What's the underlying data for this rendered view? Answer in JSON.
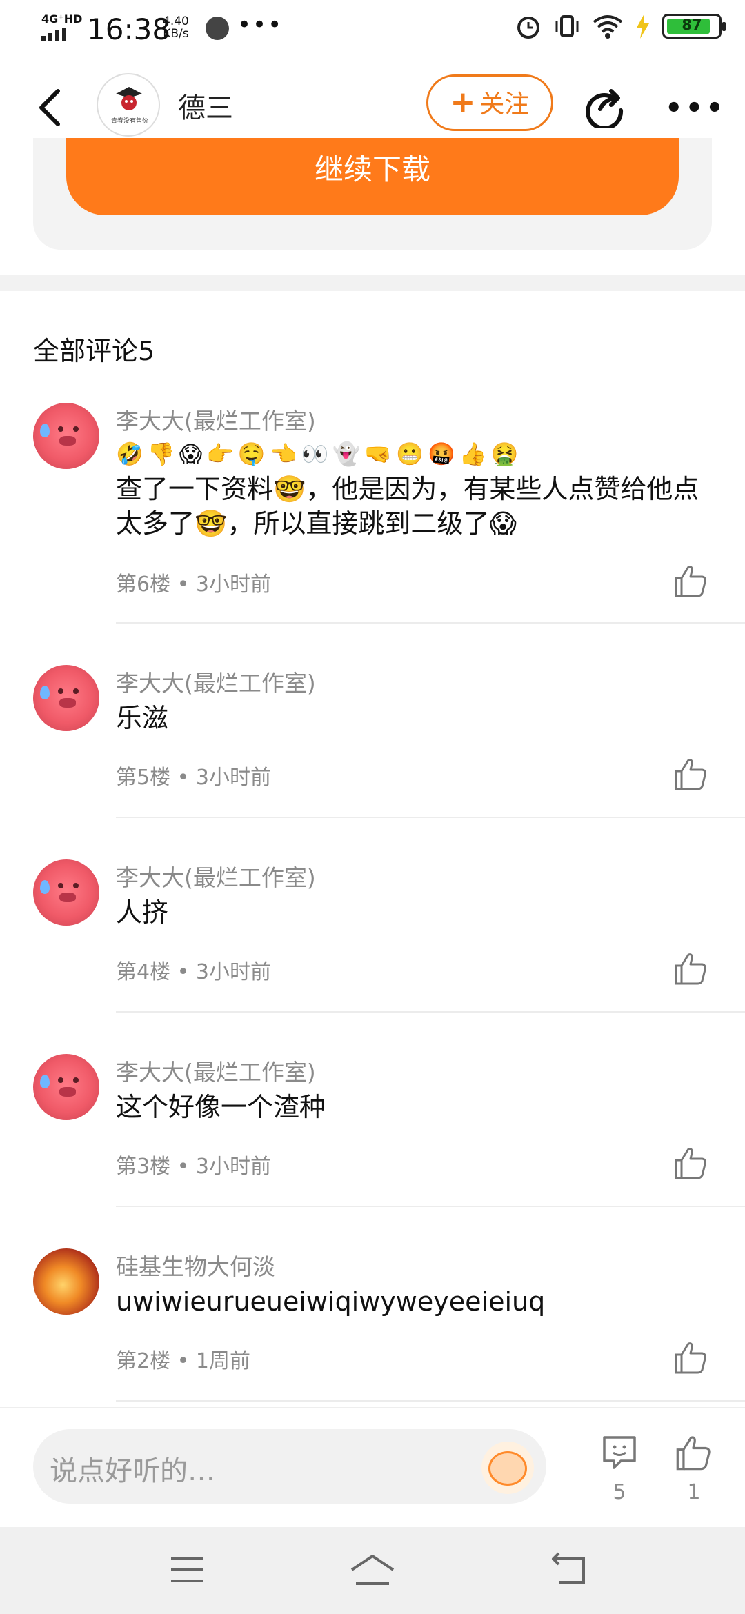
{
  "status_bar": {
    "network": "4G⁺HD",
    "time": "16:38",
    "speed_value": "4.40",
    "speed_unit": "KB/s",
    "more": "•••",
    "battery": "87"
  },
  "header": {
    "username": "德三",
    "avatar_caption": "青春没有售价",
    "follow_label": "关注",
    "follow_plus": "+",
    "more": "•••"
  },
  "download": {
    "label": "继续下载"
  },
  "comments_section": {
    "title": "全部评论5"
  },
  "comments": [
    {
      "author": "李大大(最烂工作室)",
      "emoji_line": [
        "🤣",
        "👎",
        "😱",
        "👉",
        "🤤",
        "👈",
        "👀",
        "👻",
        "🤜",
        "😬",
        "🤬",
        "👍",
        "🤮"
      ],
      "text": "查了一下资料🤓，他是因为，有某些人点赞给他点太多了🤓，所以直接跳到二级了😱",
      "meta": "第6楼 • 3小时前"
    },
    {
      "author": "李大大(最烂工作室)",
      "text": "乐滋",
      "meta": "第5楼 • 3小时前"
    },
    {
      "author": "李大大(最烂工作室)",
      "text": "人挤",
      "meta": "第4楼 • 3小时前"
    },
    {
      "author": "李大大(最烂工作室)",
      "text": "这个好像一个渣种",
      "meta": "第3楼 • 3小时前"
    },
    {
      "author": "硅基生物大何淡",
      "text": "uwiwieurueueiwiqiwyweyeeieiuq",
      "meta": "第2楼 • 1周前"
    }
  ],
  "bottom_bar": {
    "input_placeholder": "说点好听的…",
    "comment_count": "5",
    "like_count": "1"
  },
  "colors": {
    "accent": "#ff7a1a",
    "text_secondary": "#8a8a8a"
  }
}
